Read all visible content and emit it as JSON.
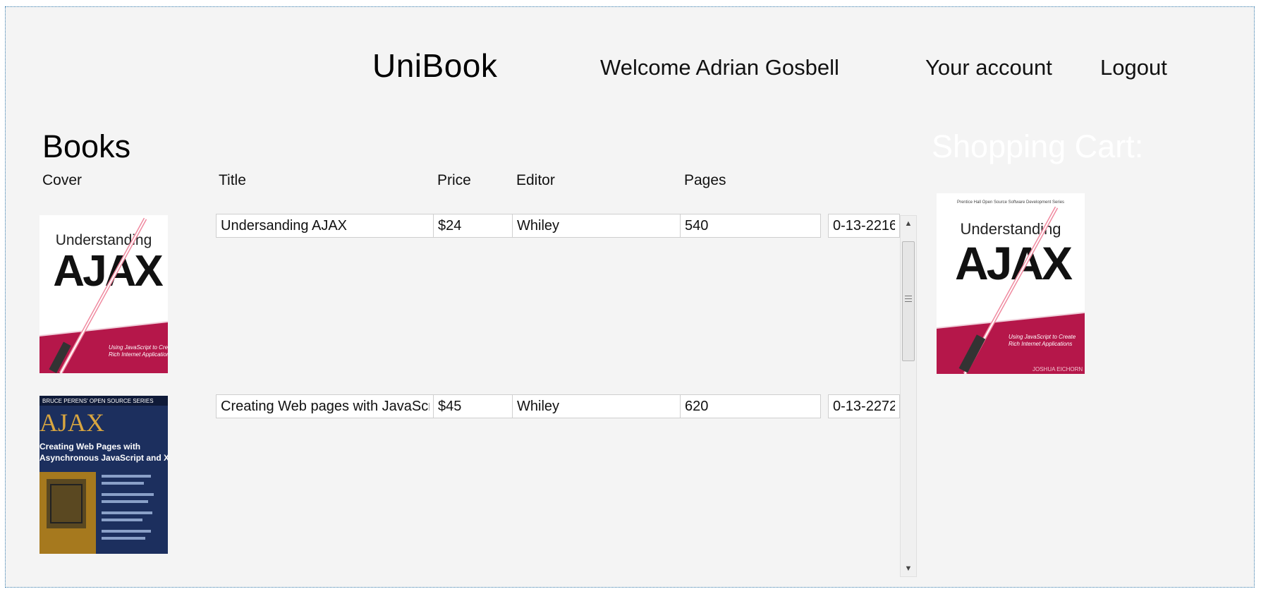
{
  "header": {
    "brand": "UniBook",
    "welcome": "Welcome Adrian Gosbell",
    "account_link": "Your account",
    "logout_link": "Logout"
  },
  "books_section": {
    "heading": "Books",
    "columns": [
      "Cover",
      "Title",
      "Price",
      "Editor",
      "Pages"
    ],
    "rows": [
      {
        "title": "Undersanding AJAX",
        "price": "$24",
        "editor": "Whiley",
        "pages": "540",
        "isbn": "0-13-2216"
      },
      {
        "title": "Creating Web pages with JavaScript",
        "price": "$45",
        "editor": "Whiley",
        "pages": "620",
        "isbn": "0-13-2272"
      }
    ]
  },
  "cart": {
    "heading": "Shopping Cart:"
  },
  "covers": [
    {
      "name": "understanding-ajax-cover",
      "texts": [
        "Understanding",
        "AJAX",
        "Using JavaScript to Create",
        "Rich Internet Applications"
      ]
    },
    {
      "name": "creating-web-pages-ajax-cover",
      "texts": [
        "BRUCE PERENS' OPEN SOURCE SERIES",
        "AJAX",
        "Creating Web Pages with",
        "Asynchronous JavaScript and XML"
      ]
    }
  ],
  "cart_item": {
    "texts": [
      "Prentice Hall Open Source Software Development Series",
      "Understanding",
      "AJAX",
      "Using JavaScript to Create",
      "Rich Internet Applications",
      "JOSHUA EICHORN"
    ]
  },
  "colors": {
    "frame_border": "#3a7fb0",
    "background": "#f4f4f4",
    "cover_accent": "#b5174a",
    "cover_navy": "#1c2f5e"
  }
}
